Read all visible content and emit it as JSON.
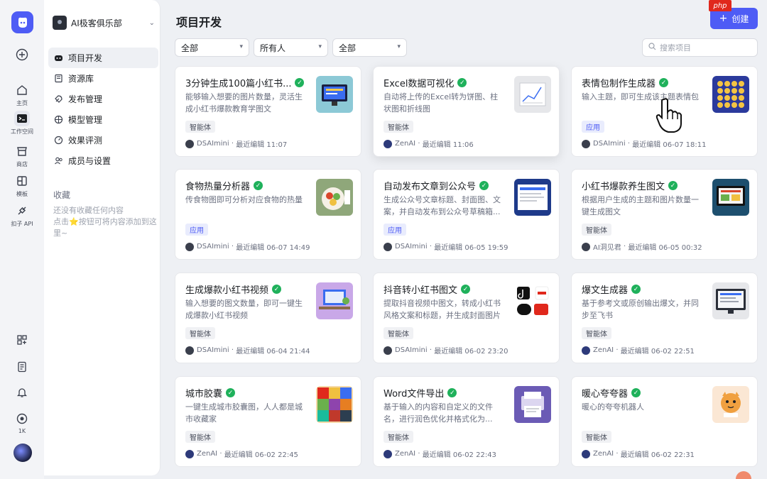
{
  "sidebar_rail": {
    "items": [
      {
        "label": "",
        "icon": "plus-circle-icon"
      },
      {
        "label": "主页",
        "icon": "home-icon"
      },
      {
        "label": "工作空间",
        "icon": "terminal-icon"
      },
      {
        "label": "商店",
        "icon": "store-icon"
      },
      {
        "label": "模板",
        "icon": "template-icon"
      },
      {
        "label": "扣子 API",
        "icon": "api-icon"
      }
    ],
    "bottom": [
      {
        "label": "",
        "icon": "apps-grid-icon"
      },
      {
        "label": "",
        "icon": "document-icon"
      },
      {
        "label": "",
        "icon": "bell-icon"
      },
      {
        "label": "1K",
        "icon": "points-icon"
      }
    ]
  },
  "workspace": {
    "name": "AI极客俱乐部"
  },
  "nav": {
    "items": [
      {
        "label": "项目开发",
        "icon": "bot-icon"
      },
      {
        "label": "资源库",
        "icon": "library-icon"
      },
      {
        "label": "发布管理",
        "icon": "rocket-icon"
      },
      {
        "label": "模型管理",
        "icon": "model-icon"
      },
      {
        "label": "效果评测",
        "icon": "gauge-icon"
      },
      {
        "label": "成员与设置",
        "icon": "members-icon"
      }
    ],
    "favorites_title": "收藏",
    "favorites_empty": "还没有收藏任何内容\n点击⭐按钮可将内容添加到这里~"
  },
  "main": {
    "title": "项目开发",
    "create_label": "创建",
    "php_badge": "php",
    "filters": [
      {
        "value": "全部"
      },
      {
        "value": "所有人"
      },
      {
        "value": "全部"
      }
    ],
    "search_placeholder": "搜索项目"
  },
  "cards": [
    {
      "title": "3分钟生成100篇小红书...",
      "desc": "能够输入想要的图片数量，灵活生成小红书爆款教育学图文",
      "tag": "智能体",
      "tag_type": "agent",
      "author": "DSAImini",
      "time": "最近编辑 11:07",
      "thumb": "monitor-blue"
    },
    {
      "title": "Excel数据可视化",
      "desc": "自动将上传的Excel转为饼图、柱状图和折线图",
      "tag": "智能体",
      "tag_type": "agent",
      "author": "ZenAI",
      "time": "最近编辑 11:06",
      "thumb": "chart-gray"
    },
    {
      "title": "表情包制作生成器",
      "desc": "输入主题，即可生成该主题表情包",
      "tag": "应用",
      "tag_type": "app",
      "author": "DSAImini",
      "time": "最近编辑 06-07 18:11",
      "thumb": "emoji-grid"
    },
    {
      "title": "食物热量分析器",
      "desc": "传食物图即可分析对应食物的热量",
      "tag": "应用",
      "tag_type": "app",
      "author": "DSAImini",
      "time": "最近编辑 06-07 14:49",
      "thumb": "food-plate"
    },
    {
      "title": "自动发布文章到公众号",
      "desc": "生成公众号文章标题、封面图、文案，并自动发布到公众号草稿箱...",
      "tag": "应用",
      "tag_type": "app",
      "author": "DSAImini",
      "time": "最近编辑 06-05 19:59",
      "thumb": "screen-navy"
    },
    {
      "title": "小红书爆款养生图文",
      "desc": "根据用户生成的主题和图片数量一键生成图文",
      "tag": "智能体",
      "tag_type": "agent",
      "author": "AI洞见君",
      "time": "最近编辑 06-05 00:32",
      "thumb": "monitor-dark"
    },
    {
      "title": "生成爆款小红书视频",
      "desc": "输入想要的图文数量，即可一键生成爆款小红书视频",
      "tag": "智能体",
      "tag_type": "agent",
      "author": "DSAImini",
      "time": "最近编辑 06-04 21:44",
      "thumb": "desk-scene"
    },
    {
      "title": "抖音转小红书图文",
      "desc": "提取抖音视频中图文，转成小红书风格文案和标题，并生成封面图片",
      "tag": "智能体",
      "tag_type": "agent",
      "author": "DSAImini",
      "time": "最近编辑 06-02 23:20",
      "thumb": "douyin-xhs"
    },
    {
      "title": "爆文生成器",
      "desc": "基于参考文或原创输出爆文，并同步至飞书",
      "tag": "智能体",
      "tag_type": "agent",
      "author": "ZenAI",
      "time": "最近编辑 06-02 22:51",
      "thumb": "monitor-white"
    },
    {
      "title": "城市胶囊",
      "desc": "一键生成城市胶囊图，人人都是城市收藏家",
      "tag": "智能体",
      "tag_type": "agent",
      "author": "ZenAI",
      "time": "最近编辑 06-02 22:45",
      "thumb": "color-blocks"
    },
    {
      "title": "Word文件导出",
      "desc": "基于输入的内容和自定义的文件名，进行润色优化并格式化为...",
      "tag": "智能体",
      "tag_type": "agent",
      "author": "ZenAI",
      "time": "最近编辑 06-02 22:43",
      "thumb": "printer-purple"
    },
    {
      "title": "暖心夸夸器",
      "desc": "暖心的夸夸机器人",
      "tag": "智能体",
      "tag_type": "agent",
      "author": "ZenAI",
      "time": "最近编辑 06-02 22:31",
      "thumb": "cat-cartoon"
    }
  ],
  "colors": {
    "accent": "#4e5cf5",
    "check": "#1fb15b"
  }
}
